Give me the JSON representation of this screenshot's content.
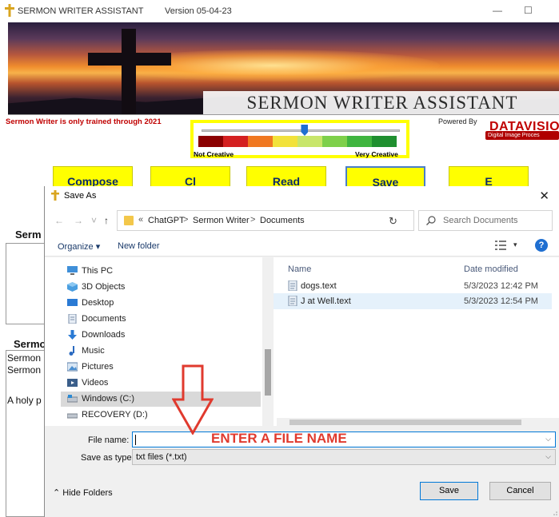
{
  "app": {
    "title": "SERMON WRITER ASSISTANT",
    "version": "Version 05-04-23",
    "window_controls": {
      "minimize": "—",
      "maximize": "☐"
    },
    "banner_title": "SERMON WRITER ASSISTANT",
    "training_note": "Sermon Writer is only trained through 2021",
    "creativity": {
      "low_label": "Not Creative",
      "high_label": "Very Creative",
      "slider_value_fraction": 0.52,
      "scale_colors": [
        "#8b0000",
        "#d42020",
        "#f07820",
        "#f2e23a",
        "#c8e66a",
        "#7ed04a",
        "#3fb53f",
        "#1f8f2f"
      ]
    },
    "powered_by": "Powered By",
    "logo": {
      "text": "DATAVISIO",
      "subtext": "Digital Image Proces"
    },
    "buttons": [
      {
        "label": "Compose"
      },
      {
        "label": "Cl"
      },
      {
        "label": "Read"
      },
      {
        "label": "Save"
      },
      {
        "label": "E"
      }
    ],
    "section_label_1": "Serm",
    "section_label_2": "Sermo",
    "background_lines": [
      "Sermon",
      "Sermon",
      "A holy p"
    ]
  },
  "dialog": {
    "title": "Save As",
    "close": "✕",
    "nav": {
      "back": "←",
      "forward": "→",
      "recent": "˅",
      "up": "↑"
    },
    "address": {
      "prefix": "«",
      "parts": [
        "ChatGPT",
        "Sermon Writer",
        "Documents"
      ],
      "separator": ">",
      "chevron": "˅",
      "refresh": "↻"
    },
    "search_placeholder": "Search Documents",
    "toolbar": {
      "organize": "Organize ▾",
      "new_folder": "New folder",
      "view_chevron": "▾",
      "help": "?"
    },
    "nav_tree": [
      {
        "label": "This PC",
        "icon": "computer-icon"
      },
      {
        "label": "3D Objects",
        "icon": "3d-objects-icon"
      },
      {
        "label": "Desktop",
        "icon": "desktop-icon"
      },
      {
        "label": "Documents",
        "icon": "documents-icon"
      },
      {
        "label": "Downloads",
        "icon": "downloads-icon"
      },
      {
        "label": "Music",
        "icon": "music-icon"
      },
      {
        "label": "Pictures",
        "icon": "pictures-icon"
      },
      {
        "label": "Videos",
        "icon": "videos-icon"
      },
      {
        "label": "Windows (C:)",
        "icon": "drive-icon"
      },
      {
        "label": "RECOVERY (D:)",
        "icon": "drive-icon"
      }
    ],
    "columns": {
      "name": "Name",
      "date": "Date modified"
    },
    "files": [
      {
        "name": "dogs.text",
        "date": "5/3/2023 12:42 PM"
      },
      {
        "name": "J at Well.text",
        "date": "5/3/2023 12:54 PM"
      }
    ],
    "file_name": {
      "label": "File name:",
      "value": ""
    },
    "save_type": {
      "label": "Save as type:",
      "value": "txt files (*.txt)"
    },
    "annotation": "ENTER A FILE NAME",
    "hide_folders": "Hide Folders",
    "save_button": "Save",
    "cancel_button": "Cancel"
  },
  "colors": {
    "accent_yellow": "#ffff00",
    "annotation_red": "#e03a2e",
    "selection_blue": "#0078d7"
  }
}
